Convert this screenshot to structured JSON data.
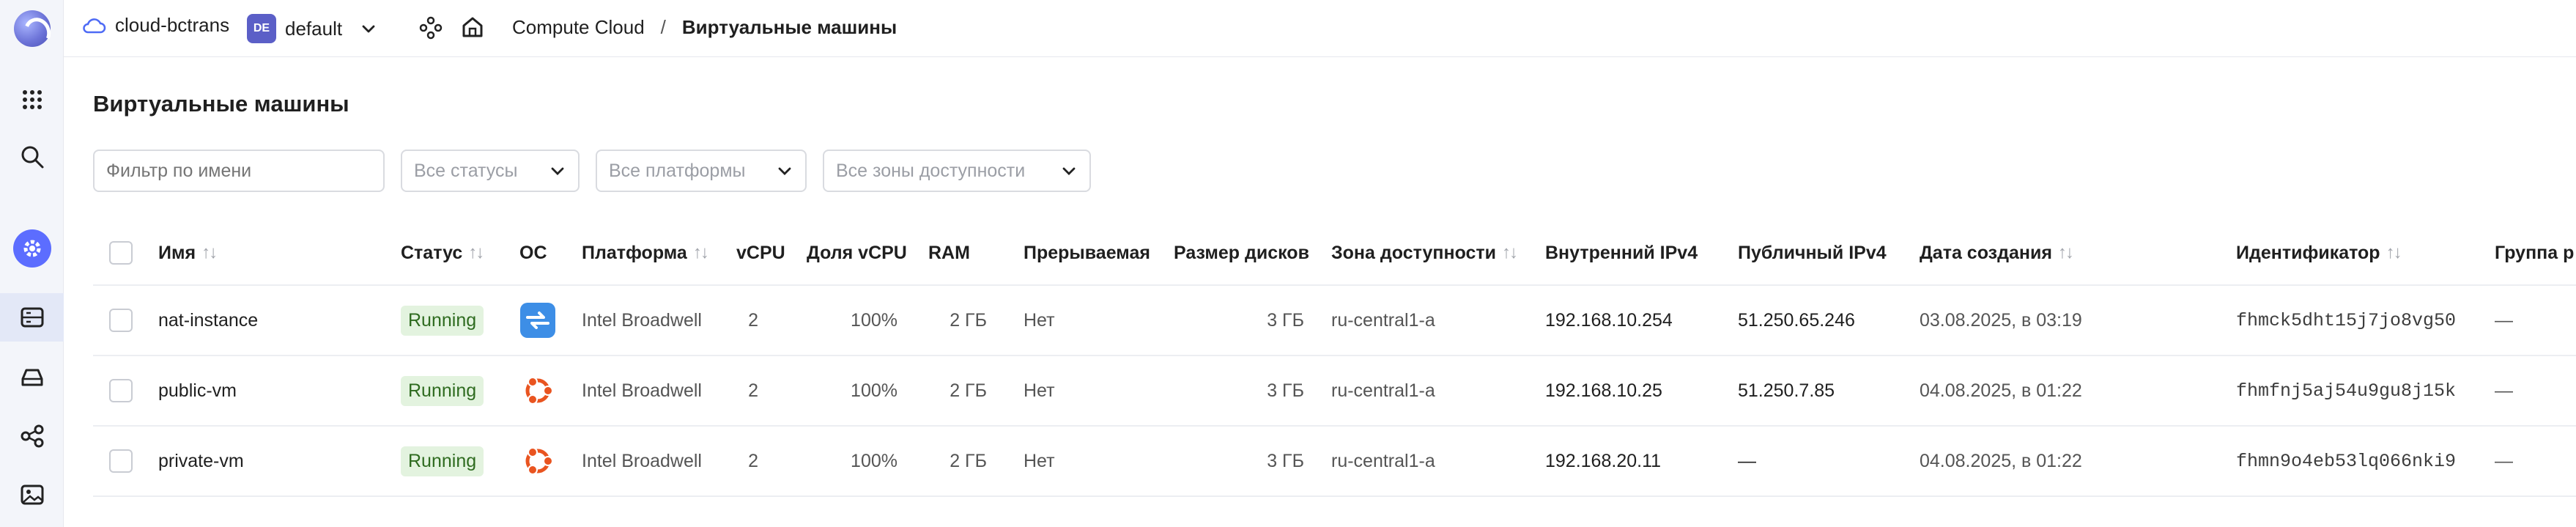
{
  "header": {
    "cloud_name": "cloud-bctrans",
    "folder_badge": "DE",
    "folder_name": "default",
    "breadcrumb_service": "Compute Cloud",
    "breadcrumb_separator": "/",
    "breadcrumb_current": "Виртуальные машины"
  },
  "page": {
    "title": "Виртуальные машины"
  },
  "filters": {
    "name_placeholder": "Фильтр по имени",
    "status": "Все статусы",
    "platform": "Все платформы",
    "zone": "Все зоны доступности"
  },
  "table": {
    "columns": {
      "name": "Имя",
      "status": "Статус",
      "os": "ОС",
      "platform": "Платформа",
      "vcpu": "vCPU",
      "vcpu_share": "Доля vCPU",
      "ram": "RAM",
      "preemptible": "Прерываемая",
      "disk_size": "Размер дисков",
      "zone": "Зона доступности",
      "internal_ip": "Внутренний IPv4",
      "public_ip": "Публичный IPv4",
      "created": "Дата создания",
      "id": "Идентификатор",
      "placement_group": "Группа р"
    },
    "rows": [
      {
        "name": "nat-instance",
        "status": "Running",
        "os_icon": "nat-os-icon",
        "platform": "Intel Broadwell",
        "vcpu": "2",
        "vcpu_share": "100%",
        "ram": "2 ГБ",
        "preemptible": "Нет",
        "disk_size": "3 ГБ",
        "zone": "ru-central1-a",
        "internal_ip": "192.168.10.254",
        "public_ip": "51.250.65.246",
        "created": "03.08.2025, в 03:19",
        "id": "fhmck5dht15j7jo8vg50",
        "placement_group": "—"
      },
      {
        "name": "public-vm",
        "status": "Running",
        "os_icon": "ubuntu-icon",
        "platform": "Intel Broadwell",
        "vcpu": "2",
        "vcpu_share": "100%",
        "ram": "2 ГБ",
        "preemptible": "Нет",
        "disk_size": "3 ГБ",
        "zone": "ru-central1-a",
        "internal_ip": "192.168.10.25",
        "public_ip": "51.250.7.85",
        "created": "04.08.2025, в 01:22",
        "id": "fhmfnj5aj54u9gu8j15k",
        "placement_group": "—"
      },
      {
        "name": "private-vm",
        "status": "Running",
        "os_icon": "ubuntu-icon",
        "platform": "Intel Broadwell",
        "vcpu": "2",
        "vcpu_share": "100%",
        "ram": "2 ГБ",
        "preemptible": "Нет",
        "disk_size": "3 ГБ",
        "zone": "ru-central1-a",
        "internal_ip": "192.168.20.11",
        "public_ip": "—",
        "created": "04.08.2025, в 01:22",
        "id": "fhmn9o4eb53lq066nki9",
        "placement_group": "—"
      }
    ]
  },
  "colors": {
    "accent": "#5c6dff",
    "status_bg": "#e3f3df",
    "status_text": "#2e6b1f",
    "ubuntu": "#e95420"
  }
}
